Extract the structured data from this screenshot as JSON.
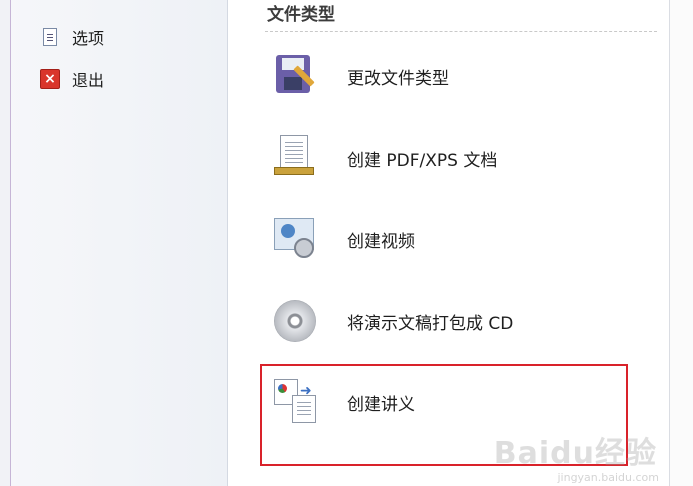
{
  "nav": {
    "items": [
      {
        "label": "选项",
        "icon": "options-icon"
      },
      {
        "label": "退出",
        "icon": "exit-icon"
      }
    ]
  },
  "section": {
    "title": "文件类型"
  },
  "commands": [
    {
      "label": "更改文件类型",
      "icon": "save-as-floppy-icon"
    },
    {
      "label": "创建 PDF/XPS 文档",
      "icon": "pdf-document-icon"
    },
    {
      "label": "创建视频",
      "icon": "video-icon"
    },
    {
      "label": "将演示文稿打包成 CD",
      "icon": "cd-icon"
    },
    {
      "label": "创建讲义",
      "icon": "handouts-icon"
    }
  ],
  "highlight_color": "#d9222a",
  "watermark": {
    "text": "Baidu经验",
    "sub": "jingyan.baidu.com"
  }
}
